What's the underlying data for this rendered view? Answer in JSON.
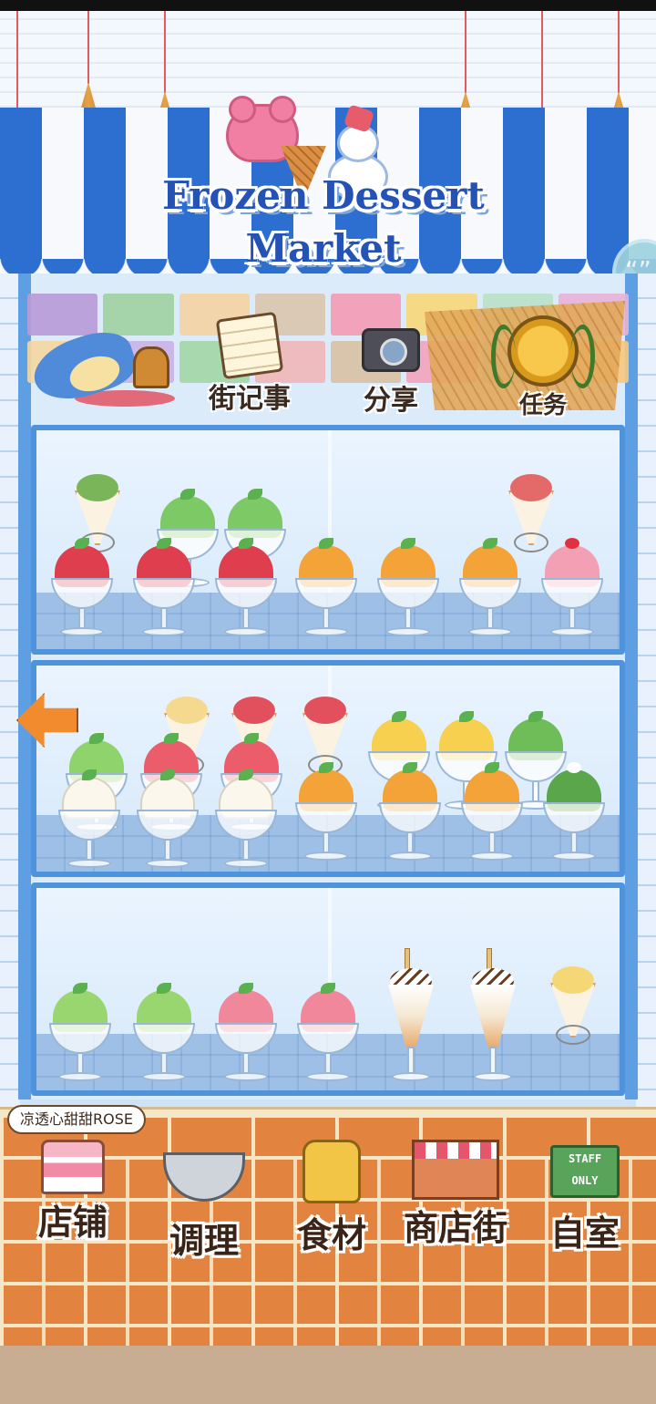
{
  "logo": {
    "line1": "Frozen Dessert",
    "line2": "Market"
  },
  "top_menu": {
    "news": "街记事",
    "share": "分享",
    "missions": "任务"
  },
  "user": {
    "name": "凉透心甜甜ROSE"
  },
  "bottom_nav": {
    "shop": "店铺",
    "cook": "调理",
    "ingredients": "食材",
    "street": "商店街",
    "home": "自室"
  },
  "staff_sign": "STAFF ONLY",
  "colors": {
    "awning_blue": "#2d6fd0",
    "frame_blue": "#4f93dc",
    "brick": "#e2843f",
    "arrow": "#f28a2e"
  },
  "icons": {
    "back": "left-arrow-icon",
    "chat": "chat-bubble-icon"
  }
}
